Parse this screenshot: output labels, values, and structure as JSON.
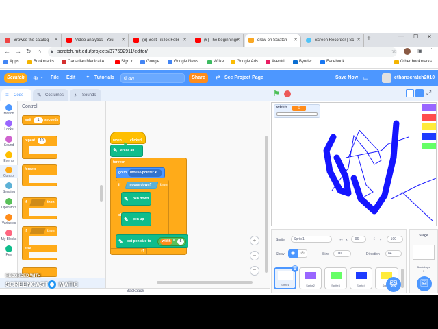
{
  "browser": {
    "tabs": [
      {
        "label": "Browse the catalog",
        "icon_color": "#e44"
      },
      {
        "label": "Video analytics - You",
        "icon_color": "#f00"
      },
      {
        "label": "(6) Best TikTok Febr",
        "icon_color": "#f00"
      },
      {
        "label": "(6) The beginnings",
        "icon_color": "#f00"
      },
      {
        "label": "draw on Scratch",
        "icon_color": "#f9a825"
      },
      {
        "label": "Screen Recorder | Sc",
        "icon_color": "#4fc3f7"
      }
    ],
    "url": "scratch.mit.edu/projects/377592911/editor/",
    "bookmarks": [
      {
        "label": "Apps",
        "icon_color": "#4285f4"
      },
      {
        "label": "Bookmarks",
        "icon_color": "#f4b400"
      },
      {
        "label": "Canadian Medical A...",
        "icon_color": "#d32f2f"
      },
      {
        "label": "Sign in",
        "icon_color": "#f00"
      },
      {
        "label": "Google",
        "icon_color": "#4285f4"
      },
      {
        "label": "Google News",
        "icon_color": "#4285f4"
      },
      {
        "label": "Wrike",
        "icon_color": "#3dbb61"
      },
      {
        "label": "Google Ads",
        "icon_color": "#fbbc04"
      },
      {
        "label": "Aventri",
        "icon_color": "#e91e63"
      },
      {
        "label": "Bynder",
        "icon_color": "#0a6ed1"
      },
      {
        "label": "Facebook",
        "icon_color": "#1877f2"
      },
      {
        "label": "Other bookmarks",
        "icon_color": "#f4b400"
      }
    ]
  },
  "menu": {
    "logo": "Scratch",
    "file": "File",
    "edit": "Edit",
    "tutorials": "Tutorials",
    "project_title": "draw",
    "share": "Share",
    "see_project_page": "See Project Page",
    "save_now": "Save Now",
    "username": "ethanscratch2010"
  },
  "editor_tabs": {
    "code": "Code",
    "costumes": "Costumes",
    "sounds": "Sounds"
  },
  "categories": [
    {
      "label": "Motion",
      "color": "#4c97ff"
    },
    {
      "label": "Looks",
      "color": "#9966ff"
    },
    {
      "label": "Sound",
      "color": "#cf63cf"
    },
    {
      "label": "Events",
      "color": "#ffbf00"
    },
    {
      "label": "Control",
      "color": "#ffab19"
    },
    {
      "label": "Sensing",
      "color": "#5cb1d6"
    },
    {
      "label": "Operators",
      "color": "#59c059"
    },
    {
      "label": "Variables",
      "color": "#ff8c1a"
    },
    {
      "label": "My Blocks",
      "color": "#ff6680"
    },
    {
      "label": "Pen",
      "color": "#0fbd8c"
    }
  ],
  "palette": {
    "heading": "Control",
    "wait": "wait",
    "wait_val": "1",
    "seconds": "seconds",
    "repeat": "repeat",
    "repeat_val": "10",
    "forever": "forever",
    "if": "if",
    "then": "then",
    "else": "else"
  },
  "script": {
    "when_clicked": "when",
    "clicked": "clicked",
    "erase_all": "erase all",
    "forever": "forever",
    "go_to": "go to",
    "mouse_pointer": "mouse-pointer",
    "if": "if",
    "mouse_down": "mouse down?",
    "then": "then",
    "pen_down": "pen down",
    "else": "else",
    "pen_up": "pen up",
    "set_pen_size": "set pen size to",
    "width_var": "width",
    "times": "*",
    "factor": "5"
  },
  "stage": {
    "monitor_label": "width",
    "monitor_value": "0",
    "swatches": [
      "#9966ff",
      "#ff4d4d",
      "#ffeb3b",
      "#1e3cff",
      "#66ff66"
    ]
  },
  "sprite_info": {
    "sprite_label": "Sprite",
    "sprite_name": "Sprite1",
    "x_label": "x",
    "x_value": "-96",
    "y_label": "y",
    "y_value": "-100",
    "show_label": "Show",
    "size_label": "Size",
    "size_value": "100",
    "direction_label": "Direction",
    "direction_value": "84"
  },
  "sprites": [
    {
      "label": "Sprite1",
      "color": "#ffffff"
    },
    {
      "label": "Sprite2",
      "color": "#9966ff"
    },
    {
      "label": "Sprite3",
      "color": "#66ff66"
    },
    {
      "label": "Sprite4",
      "color": "#1e3cff"
    },
    {
      "label": "Sprite5",
      "color": "#ffeb3b"
    }
  ],
  "stage_panel": {
    "title": "Stage",
    "backdrops": "Backdrops",
    "backdrops_count": "1"
  },
  "backpack": "Backpack",
  "watermark": {
    "line1": "RECORDED WITH",
    "line2": "SCREENCAST",
    "line3": "MATIC"
  }
}
